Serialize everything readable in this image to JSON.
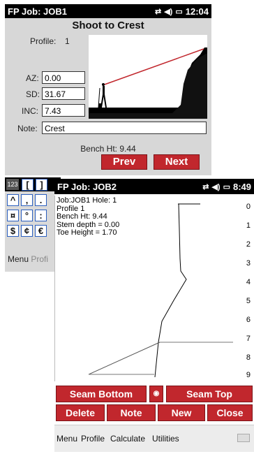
{
  "win1": {
    "title": "FP Job: JOB1",
    "time": "12:04",
    "heading": "Shoot to Crest",
    "profile_label": "Profile:",
    "profile_value": "1",
    "az_label": "AZ:",
    "az_value": "0.00",
    "sd_label": "SD:",
    "sd_value": "31.67",
    "inc_label": "INC:",
    "inc_value": "7.43",
    "note_label": "Note:",
    "note_value": "Crest",
    "bench": "Bench Ht: 9.44",
    "prev": "Prev",
    "next": "Next"
  },
  "keyboard": {
    "mode_label": "123",
    "keys": [
      "[",
      "]",
      "^",
      ",",
      ".",
      "¤",
      "°",
      ":",
      "$",
      "¢",
      "€"
    ],
    "menu": "Menu",
    "menu_ghost": "Profi"
  },
  "win2": {
    "title": "FP Job: JOB2",
    "time": "8:49",
    "info": {
      "line1": "Job:JOB1 Hole: 1",
      "line2": "Profile 1",
      "line3": "Bench Ht: 9.44",
      "line4": "Stem depth = 0.00",
      "line5": "Toe Height = 1.70"
    },
    "depth_scale": [
      "0",
      "1",
      "2",
      "3",
      "4",
      "5",
      "6",
      "7",
      "8",
      "9"
    ],
    "buttons": {
      "seam_bottom": "Seam Bottom",
      "seam_top": "Seam Top",
      "delete": "Delete",
      "note": "Note",
      "new": "New",
      "close": "Close"
    },
    "menu": {
      "menu": "Menu",
      "profile": "Profile",
      "calculate": "Calculate",
      "utilities": "Utilities"
    }
  }
}
